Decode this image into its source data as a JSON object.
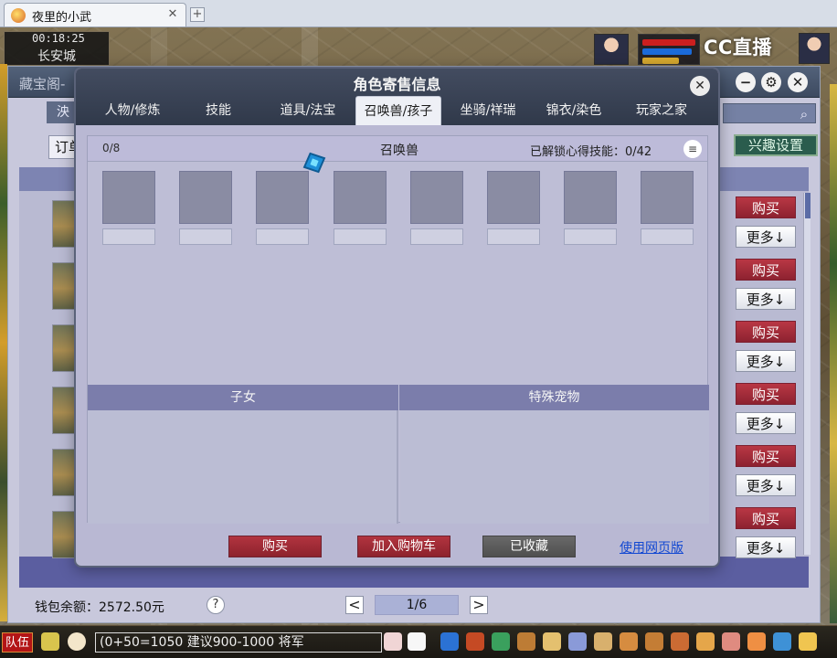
{
  "browser": {
    "tab_title": "夜里的小武",
    "close_glyph": "✕",
    "new_tab_glyph": "+"
  },
  "game": {
    "clock": "00:18:25",
    "location": "长安城",
    "cc_logo": "CC直播",
    "health_color": "#cc1f1f",
    "mana_color": "#1b6bd9"
  },
  "shop": {
    "window_title": "藏宝阁-",
    "tab_fragment": "泱",
    "order_label": "订单",
    "interest_label": "兴趣设置",
    "buy_label": "购买",
    "more_label": "更多↓",
    "wallet_label": "钱包余额：2572.50元",
    "help_glyph": "?",
    "page_indicator": "1/6",
    "prev_glyph": "<",
    "next_glyph": ">",
    "window_controls": {
      "minimize": "−",
      "settings": "⚙",
      "close": "✕"
    },
    "search_icon_name": "search-icon"
  },
  "dialog": {
    "title": "角色寄售信息",
    "close_glyph": "✕",
    "tabs": [
      {
        "label": "人物/修炼"
      },
      {
        "label": "技能"
      },
      {
        "label": "道具/法宝"
      },
      {
        "label": "召唤兽/孩子"
      },
      {
        "label": "坐骑/祥瑞"
      },
      {
        "label": "锦衣/染色"
      },
      {
        "label": "玩家之家"
      }
    ],
    "active_tab": "召唤兽/孩子",
    "summons_count": "0/8",
    "summons_title": "召唤兽",
    "unlock_text": "已解锁心得技能：0/42",
    "menu_glyph": "≡",
    "children_title": "子女",
    "special_pets_title": "特殊宠物",
    "buy_button": "购买",
    "add_cart_button": "加入购物车",
    "favorited_button": "已收藏",
    "web_version_link": "使用网页版"
  },
  "taskbar": {
    "team_button": "队伍",
    "chat_text": "(0+50=1050  建议900-1000  将军"
  }
}
